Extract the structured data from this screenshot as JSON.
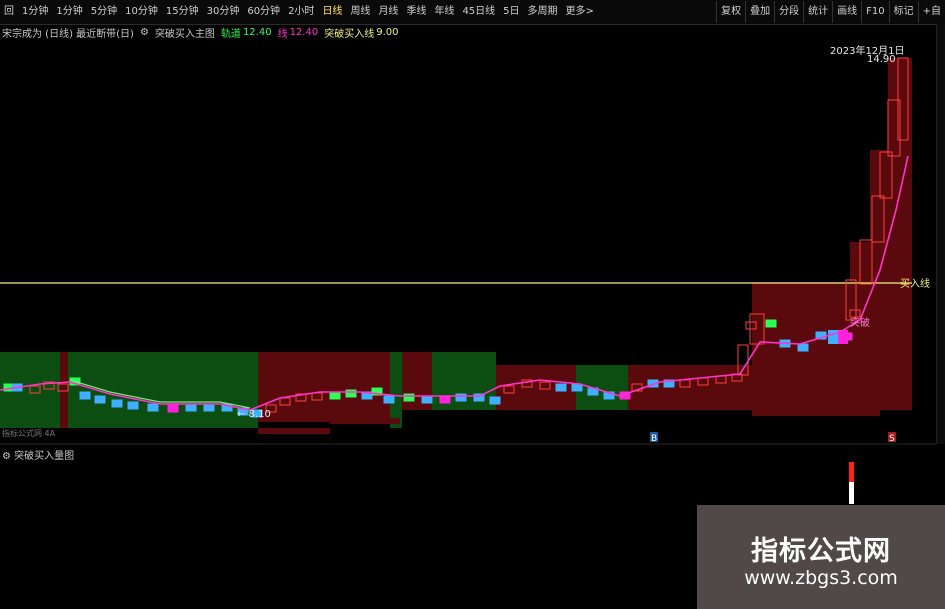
{
  "toolbar": {
    "items": [
      {
        "label": "回",
        "active": false
      },
      {
        "label": "1分钟",
        "active": false
      },
      {
        "label": "1分钟",
        "active": false
      },
      {
        "label": "5分钟",
        "active": false
      },
      {
        "label": "10分钟",
        "active": false
      },
      {
        "label": "15分钟",
        "active": false
      },
      {
        "label": "30分钟",
        "active": false
      },
      {
        "label": "60分钟",
        "active": false
      },
      {
        "label": "2小时",
        "active": false
      },
      {
        "label": "日线",
        "active": true
      },
      {
        "label": "周线",
        "active": false
      },
      {
        "label": "月线",
        "active": false
      },
      {
        "label": "季线",
        "active": false
      },
      {
        "label": "年线",
        "active": false
      },
      {
        "label": "45日线",
        "active": false
      },
      {
        "label": "5日",
        "active": false
      },
      {
        "label": "多周期",
        "active": false
      },
      {
        "label": "更多>",
        "active": false
      }
    ],
    "right_items": [
      "复权",
      "叠加",
      "分段",
      "统计",
      "画线",
      "F10",
      "标记",
      "+自"
    ]
  },
  "legend": {
    "prefix": "宋宗成为 (日线) 最近断带(日)",
    "indicator_name": "突破买入主图",
    "line1_label": "轨道",
    "line1_value": "12.40",
    "line2_label": "线",
    "line2_value": "12.40",
    "line3_label": "突破买入线",
    "line3_value": "9.00"
  },
  "chart_labels": {
    "date_tip": "2023年12月1日",
    "price_tip": "14.90",
    "breakout_label": "突破",
    "low_label": "← 8.10",
    "level_label": "买入线",
    "bottom_left": "指标公式网 4A",
    "marker_buy": "B",
    "marker_sell": "S"
  },
  "sub_panel": {
    "title": "突破买入量图"
  },
  "watermark": {
    "title": "指标公式网",
    "url": "www.zbgs3.com"
  },
  "colors": {
    "background": "#000000",
    "green_zone": "#0c4d12",
    "red_zone": "#5a0a0c",
    "ma_line": "#ff33cc",
    "level_line": "#f0f07a",
    "bull_candle": "#ff4040",
    "bear_cyan": "#3fb0ff",
    "bright_green": "#2aff55",
    "magenta": "#ff22dd"
  }
}
